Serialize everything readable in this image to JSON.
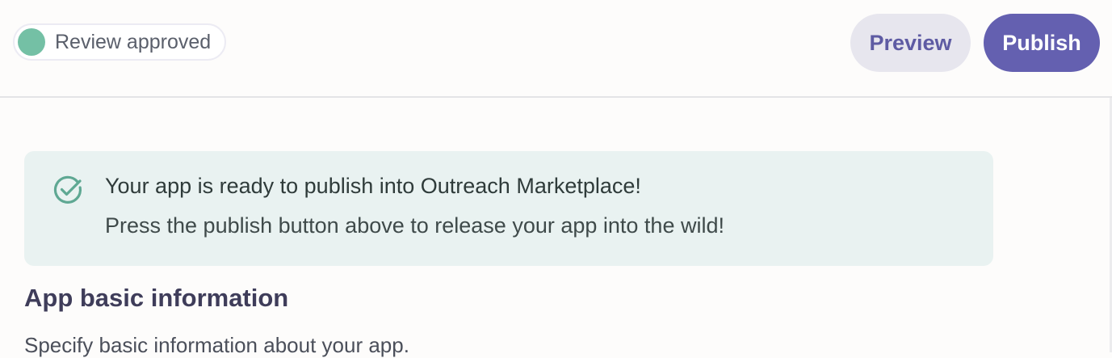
{
  "colors": {
    "approved_dot": "#74c0a5",
    "accent": "#6460b0",
    "preview_text": "#5e5ba3",
    "notice_bg": "#e9f2f1",
    "check_icon": "#5fa893"
  },
  "header": {
    "status": {
      "label": "Review approved",
      "icon": "status-dot"
    },
    "preview_label": "Preview",
    "publish_label": "Publish"
  },
  "notice": {
    "icon": "check-circle-icon",
    "title": "Your app is ready to publish into Outreach Marketplace!",
    "body": "Press the publish button above to release your app into the wild!"
  },
  "section": {
    "title": "App basic information",
    "description": "Specify basic information about your app."
  }
}
